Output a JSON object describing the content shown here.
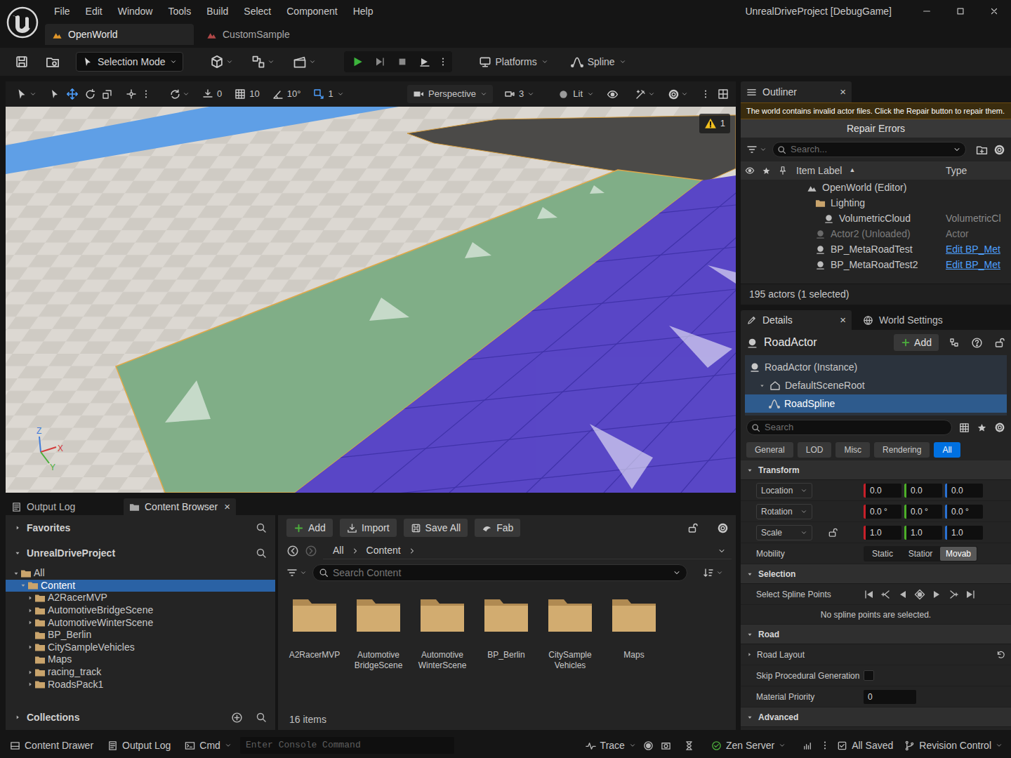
{
  "window": {
    "title": "UnrealDriveProject [DebugGame]"
  },
  "menu": [
    "File",
    "Edit",
    "Window",
    "Tools",
    "Build",
    "Select",
    "Component",
    "Help"
  ],
  "level_tabs": [
    {
      "label": "OpenWorld",
      "selected": true
    },
    {
      "label": "CustomSample",
      "selected": false
    }
  ],
  "toolbar": {
    "selection_mode": "Selection Mode",
    "platforms": "Platforms",
    "spline": "Spline"
  },
  "viewport": {
    "snaps": [
      "0",
      "10",
      "10°",
      "1"
    ],
    "view_mode": "Perspective",
    "camera_speed": "3",
    "lighting": "Lit",
    "warning_count": "1",
    "gizmo": {
      "z": "Z",
      "x": "X",
      "y": "Y"
    }
  },
  "outliner": {
    "title": "Outliner",
    "close": "×",
    "warning": "The world contains invalid actor files. Click the Repair button to repair them.",
    "repair_button": "Repair Errors",
    "search_placeholder": "Search...",
    "columns": {
      "label": "Item Label",
      "sort_arrow": "▲",
      "type": "Type"
    },
    "rows": [
      {
        "label": "OpenWorld (Editor)",
        "depth": 0,
        "kind": "world",
        "unloaded": false
      },
      {
        "label": "Lighting",
        "depth": 1,
        "kind": "folder",
        "unloaded": false
      },
      {
        "label": "VolumetricCloud",
        "type": "VolumetricCl",
        "depth": 2,
        "kind": "actor",
        "unloaded": false
      },
      {
        "label": "Actor2 (Unloaded)",
        "type": "Actor",
        "depth": 1,
        "kind": "actor",
        "unloaded": true
      },
      {
        "label": "BP_MetaRoadTest",
        "type": "Edit BP_Met",
        "depth": 1,
        "kind": "blueprint",
        "unloaded": false
      },
      {
        "label": "BP_MetaRoadTest2",
        "type": "Edit BP_Met",
        "depth": 1,
        "kind": "blueprint",
        "unloaded": false
      }
    ],
    "footer": "195 actors (1 selected)"
  },
  "details": {
    "tabs": [
      {
        "label": "Details",
        "selected": true
      },
      {
        "label": "World Settings",
        "selected": false
      }
    ],
    "close": "×",
    "actor": "RoadActor",
    "add": "Add",
    "components": [
      {
        "label": "RoadActor (Instance)",
        "depth": 0,
        "kind": "actor",
        "selected": false
      },
      {
        "label": "DefaultSceneRoot",
        "depth": 1,
        "kind": "scene_root",
        "expanded": true,
        "selected": false
      },
      {
        "label": "RoadSpline",
        "depth": 2,
        "kind": "spline",
        "selected": true
      }
    ],
    "search_placeholder": "Search",
    "filters": [
      {
        "label": "General",
        "selected": false
      },
      {
        "label": "LOD",
        "selected": false
      },
      {
        "label": "Misc",
        "selected": false
      },
      {
        "label": "Rendering",
        "selected": false
      },
      {
        "label": "All",
        "selected": true
      }
    ],
    "transform": {
      "title": "Transform",
      "expanded": true,
      "rows": [
        {
          "label": "Location",
          "values": [
            "0.0",
            "0.0",
            "0.0"
          ]
        },
        {
          "label": "Rotation",
          "values": [
            "0.0 °",
            "0.0 °",
            "0.0 °"
          ]
        },
        {
          "label": "Scale",
          "values": [
            "1.0",
            "1.0",
            "1.0"
          ],
          "ratio_locked": false
        }
      ],
      "mobility": {
        "label": "Mobility",
        "options": [
          {
            "label": "Static",
            "selected": false
          },
          {
            "label": "Statior",
            "selected": false
          },
          {
            "label": "Movab",
            "selected": true
          }
        ]
      }
    },
    "selection": {
      "title": "Selection",
      "expanded": true,
      "label": "Select Spline Points",
      "message": "No spline points are selected."
    },
    "road": {
      "title": "Road",
      "expanded": true,
      "rows": [
        {
          "kind": "group",
          "label": "Road Layout",
          "expanded": false
        },
        {
          "kind": "checkbox",
          "label": "Skip Procedural Generation",
          "checked": false
        },
        {
          "kind": "number",
          "label": "Material Priority",
          "value": "0"
        }
      ]
    },
    "advanced": {
      "title": "Advanced",
      "expanded": true
    }
  },
  "content_browser": {
    "tabs": [
      {
        "label": "Output Log",
        "selected": false
      },
      {
        "label": "Content Browser",
        "selected": true
      }
    ],
    "close": "×",
    "sources": {
      "favorites": {
        "label": "Favorites",
        "expanded": false
      },
      "project": {
        "label": "UnrealDriveProject",
        "expanded": true
      },
      "tree": [
        {
          "label": "All",
          "depth": 0,
          "has_children": true,
          "expanded": true,
          "selected": false
        },
        {
          "label": "Content",
          "depth": 1,
          "has_children": true,
          "expanded": true,
          "selected": true
        },
        {
          "label": "A2RacerMVP",
          "depth": 2,
          "has_children": true,
          "expanded": false,
          "selected": false
        },
        {
          "label": "AutomotiveBridgeScene",
          "depth": 2,
          "has_children": true,
          "expanded": false,
          "selected": false
        },
        {
          "label": "AutomotiveWinterScene",
          "depth": 2,
          "has_children": true,
          "expanded": false,
          "selected": false
        },
        {
          "label": "BP_Berlin",
          "depth": 2,
          "has_children": false,
          "selected": false
        },
        {
          "label": "CitySampleVehicles",
          "depth": 2,
          "has_children": true,
          "expanded": false,
          "selected": false
        },
        {
          "label": "Maps",
          "depth": 2,
          "has_children": false,
          "selected": false
        },
        {
          "label": "racing_track",
          "depth": 2,
          "has_children": true,
          "expanded": false,
          "selected": false
        },
        {
          "label": "RoadsPack1",
          "depth": 2,
          "has_children": true,
          "expanded": false,
          "selected": false
        }
      ],
      "collections": {
        "label": "Collections",
        "expanded": false
      }
    },
    "actions": [
      "Add",
      "Import",
      "Save All",
      "Fab"
    ],
    "path": [
      "All",
      "Content"
    ],
    "search_placeholder": "Search Content",
    "folders": [
      "A2RacerMVP",
      "Automotive BridgeScene",
      "Automotive WinterScene",
      "BP_Berlin",
      "CitySample Vehicles",
      "Maps"
    ],
    "count": "16 items"
  },
  "status_bar": {
    "left": [
      "Content Drawer",
      "Output Log",
      "Cmd"
    ],
    "console_placeholder": "Enter Console Command",
    "right": [
      "Trace",
      "Zen Server",
      "All Saved",
      "Revision Control"
    ]
  }
}
